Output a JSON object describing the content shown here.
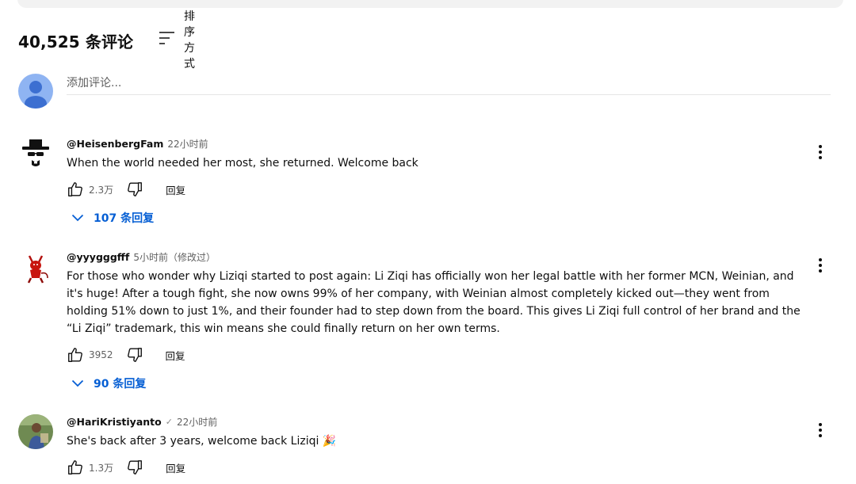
{
  "header": {
    "count": "40,525 条评论",
    "sort_label": "排序方式",
    "sort_icon": "sort-icon"
  },
  "add_comment": {
    "placeholder": "添加评论..."
  },
  "comments": [
    {
      "author": "@HeisenbergFam",
      "time": "22小时前",
      "text": "When the world needed her most, she returned. Welcome back",
      "likes": "2.3万",
      "reply_label": "回复",
      "replies": "107 条回复",
      "avatar_icon": "heisenberg-avatar"
    },
    {
      "author": "@yyygggfff",
      "time": "5小时前（修改过）",
      "text": "For those who wonder why Liziqi started to post again: Li Ziqi has officially won her legal battle with her former MCN, Weinian, and it's huge! After a tough fight, she now owns 99% of her company, with Weinian almost completely kicked out—they went from holding 51% down to just 1%, and their founder had to step down from the board. This gives Li Ziqi full control of her brand and the “Li Ziqi” trademark, this win means she could finally return on her own terms.",
      "likes": "3952",
      "reply_label": "回复",
      "replies": "90 条回复",
      "avatar_icon": "devil-avatar"
    },
    {
      "author": "@HariKristiyanto",
      "verified": "✓",
      "time": "22小时前",
      "text": "She's back after 3 years, welcome back Liziqi 🎉",
      "likes": "1.3万",
      "reply_label": "回复",
      "avatar_icon": "photo-avatar"
    }
  ]
}
